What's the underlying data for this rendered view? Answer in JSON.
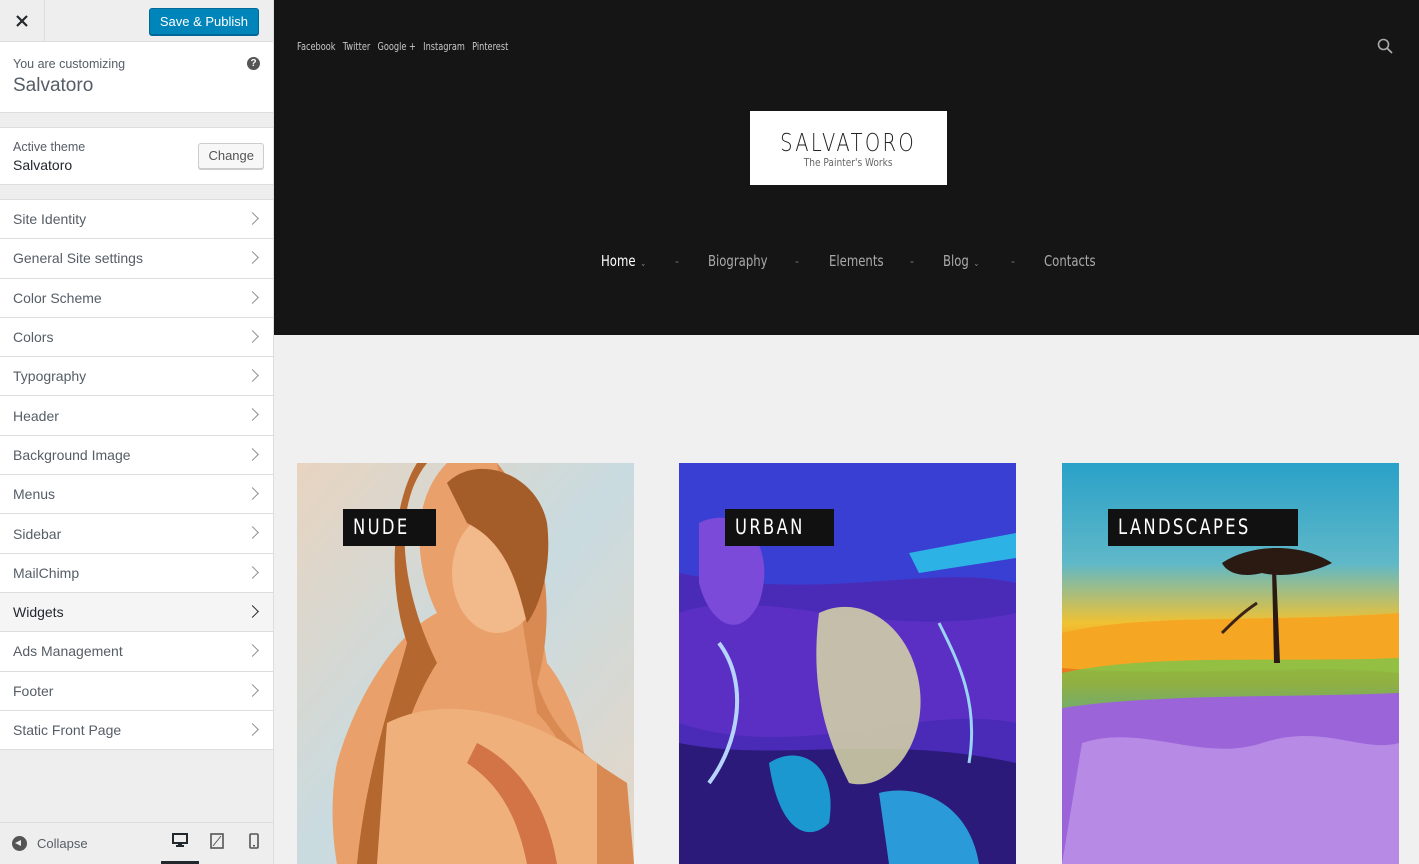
{
  "customizer": {
    "close_icon": "close-icon",
    "save_label": "Save & Publish",
    "info_label": "You are customizing",
    "site_title": "Salvatoro",
    "active_theme_label": "Active theme",
    "active_theme_name": "Salvatoro",
    "change_label": "Change",
    "panels": [
      {
        "label": "Site Identity"
      },
      {
        "label": "General Site settings"
      },
      {
        "label": "Color Scheme"
      },
      {
        "label": "Colors"
      },
      {
        "label": "Typography"
      },
      {
        "label": "Header"
      },
      {
        "label": "Background Image"
      },
      {
        "label": "Menus"
      },
      {
        "label": "Sidebar"
      },
      {
        "label": "MailChimp"
      },
      {
        "label": "Widgets",
        "active": true
      },
      {
        "label": "Ads Management"
      },
      {
        "label": "Footer"
      },
      {
        "label": "Static Front Page"
      }
    ],
    "collapse_label": "Collapse",
    "preview_devices": [
      "desktop",
      "tablet",
      "mobile"
    ],
    "active_device": "desktop",
    "accent_color": "#0085ba"
  },
  "preview": {
    "social_links": [
      "Facebook",
      "Twitter",
      "Google +",
      "Instagram",
      "Pinterest"
    ],
    "logo": {
      "title": "SALVATORO",
      "tagline": "The Painter's Works"
    },
    "nav": [
      {
        "label": "Home",
        "has_submenu": true,
        "current": true
      },
      {
        "label": "Biography",
        "has_submenu": false
      },
      {
        "label": "Elements",
        "has_submenu": false
      },
      {
        "label": "Blog",
        "has_submenu": true
      },
      {
        "label": "Contacts",
        "has_submenu": false
      }
    ],
    "nav_separator": "-",
    "categories": [
      {
        "label": "NUDE"
      },
      {
        "label": "URBAN"
      },
      {
        "label": "LANDSCAPES"
      }
    ],
    "header_bg": "#151515",
    "body_bg": "#f0f0f0"
  }
}
